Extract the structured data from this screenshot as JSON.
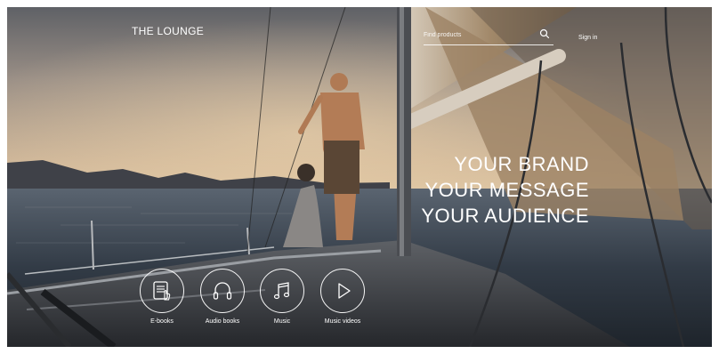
{
  "header": {
    "logo": "THE LOUNGE",
    "search_placeholder": "Find products",
    "sign_in": "Sign in"
  },
  "hero": {
    "lines": [
      "YOUR BRAND",
      "YOUR MESSAGE",
      "YOUR AUDIENCE"
    ]
  },
  "categories": [
    {
      "label": "E-books",
      "icon": "ebook-icon"
    },
    {
      "label": "Audio books",
      "icon": "headphones-icon"
    },
    {
      "label": "Music",
      "icon": "music-note-icon"
    },
    {
      "label": "Music videos",
      "icon": "play-icon"
    }
  ],
  "colors": {
    "text": "#ffffff"
  }
}
